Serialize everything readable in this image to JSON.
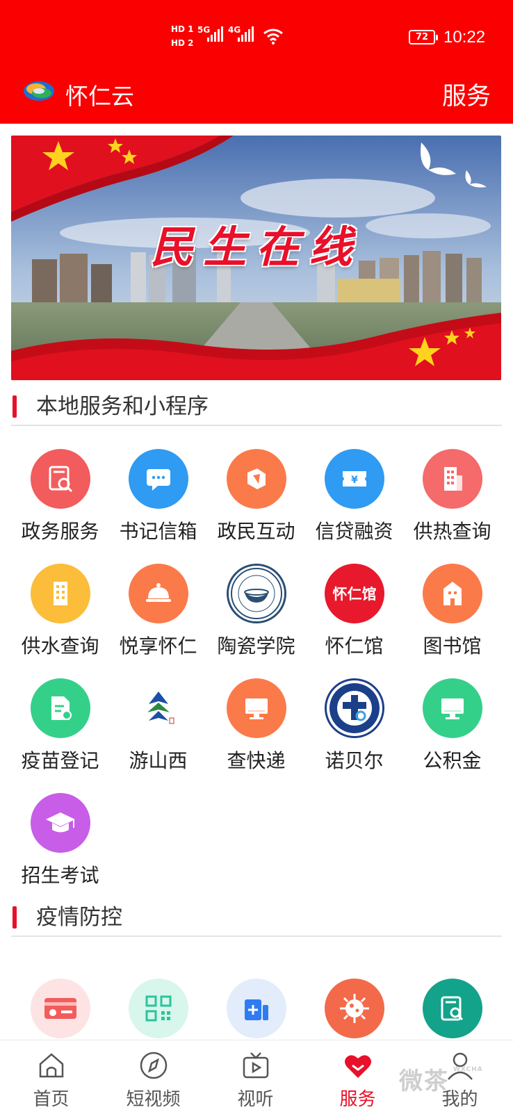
{
  "status_bar": {
    "hd1": "HD 1",
    "hd2": "HD 2",
    "net1": "5G",
    "net2": "4G",
    "battery": "72",
    "time": "10:22"
  },
  "header": {
    "title": "怀仁云",
    "service_link": "服务",
    "background": "#fb0000"
  },
  "banner": {
    "text": "民生在线"
  },
  "sections": {
    "local_services": "本地服务和小程序",
    "epidemic": "疫情防控"
  },
  "services": [
    {
      "label": "政务服务",
      "icon": "document-search-icon",
      "color": "#f25c5c"
    },
    {
      "label": "书记信箱",
      "icon": "chat-bubble-icon",
      "color": "#2f9bf2"
    },
    {
      "label": "政民互动",
      "icon": "interaction-icon",
      "color": "#fb7a4a"
    },
    {
      "label": "信贷融资",
      "icon": "ticket-yuan-icon",
      "color": "#2f9bf2"
    },
    {
      "label": "供热查询",
      "icon": "building-icon",
      "color": "#f56a6a"
    },
    {
      "label": "供水查询",
      "icon": "building-icon",
      "color": "#fbbd3a"
    },
    {
      "label": "悦享怀仁",
      "icon": "food-cloche-icon",
      "color": "#fb7a4a"
    },
    {
      "label": "陶瓷学院",
      "icon": "college-seal-icon",
      "color": "#ffffff"
    },
    {
      "label": "怀仁馆",
      "icon": "huairen-hall-icon",
      "color": "#e8192c",
      "icon_text": "怀仁馆"
    },
    {
      "label": "图书馆",
      "icon": "building-icon",
      "color": "#fb7a4a"
    },
    {
      "label": "疫苗登记",
      "icon": "vaccine-doc-icon",
      "color": "#34d08a"
    },
    {
      "label": "游山西",
      "icon": "shanxi-tour-logo-icon",
      "color": "#ffffff"
    },
    {
      "label": "查快递",
      "icon": "monitor-icon",
      "color": "#fb7a4a"
    },
    {
      "label": "诺贝尔",
      "icon": "hospital-seal-icon",
      "color": "#ffffff"
    },
    {
      "label": "公积金",
      "icon": "monitor-icon",
      "color": "#34d08a"
    },
    {
      "label": "招生考试",
      "icon": "graduation-cap-icon",
      "color": "#c85de8"
    }
  ],
  "epidemic_services": [
    {
      "icon": "health-card-icon",
      "color": "#f25c5c"
    },
    {
      "icon": "qr-code-icon",
      "color": "#2bc49a"
    },
    {
      "icon": "add-chart-icon",
      "color": "#2f7bf2"
    },
    {
      "icon": "virus-icon",
      "color": "#f26a4a"
    },
    {
      "icon": "search-doc-icon",
      "color": "#12a38a"
    }
  ],
  "tabs": [
    {
      "label": "首页",
      "icon": "home-icon"
    },
    {
      "label": "短视频",
      "icon": "compass-icon"
    },
    {
      "label": "视听",
      "icon": "tv-play-icon"
    },
    {
      "label": "服务",
      "icon": "heart-icon",
      "active": true
    },
    {
      "label": "我的",
      "icon": "person-icon"
    }
  ],
  "watermark": {
    "text": "微茶",
    "sub": "WXCHA"
  }
}
